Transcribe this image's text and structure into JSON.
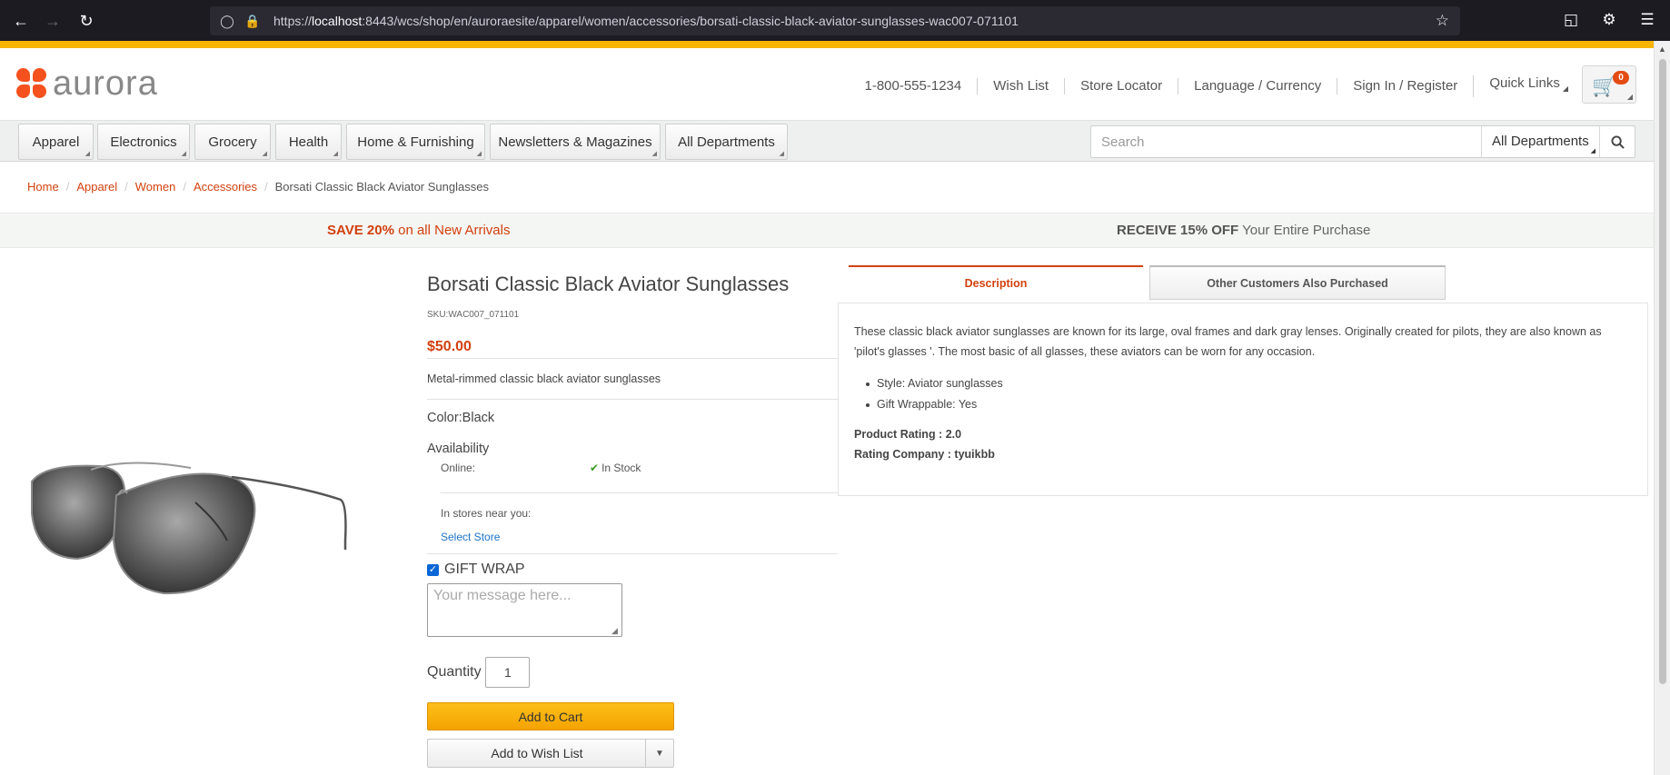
{
  "browser": {
    "url_prefix": "https://",
    "url_host": "localhost",
    "url_rest": ":8443/wcs/shop/en/auroraesite/apparel/women/accessories/borsati-classic-black-aviator-sunglasses-wac007-071101"
  },
  "header": {
    "logo_text": "aurora",
    "links": [
      "1-800-555-1234",
      "Wish List",
      "Store Locator",
      "Language / Currency",
      "Sign In / Register",
      "Quick Links"
    ],
    "cart_count": "0"
  },
  "departments": [
    "Apparel",
    "Electronics",
    "Grocery",
    "Health",
    "Home & Furnishing",
    "Newsletters & Magazines",
    "All Departments"
  ],
  "search": {
    "placeholder": "Search",
    "scope": "All Departments"
  },
  "breadcrumb": [
    "Home",
    "Apparel",
    "Women",
    "Accessories",
    "Borsati Classic Black Aviator Sunglasses"
  ],
  "promo": {
    "left_bold": "SAVE 20%",
    "left_rest": " on all New Arrivals",
    "right_bold": "RECEIVE 15% OFF",
    "right_rest": " Your Entire Purchase"
  },
  "product": {
    "title": "Borsati Classic Black Aviator Sunglasses",
    "sku": "SKU:WAC007_071101",
    "price": "$50.00",
    "short_desc": "Metal-rimmed classic black aviator sunglasses",
    "color": "Color:Black",
    "availability_label": "Availability",
    "online_label": "Online:",
    "stock_status": "In Stock",
    "stores_label": "In stores near you:",
    "select_store": "Select Store",
    "gift_wrap_label": "GIFT WRAP",
    "gift_wrap_checked": true,
    "gift_msg_placeholder": "Your message here...",
    "quantity_label": "Quantity",
    "quantity_value": "1",
    "add_to_cart": "Add to Cart",
    "add_to_wishlist": "Add to Wish List"
  },
  "tabs": {
    "description": "Description",
    "other": "Other Customers Also Purchased"
  },
  "description": {
    "text": "These classic black aviator sunglasses are known for its large, oval frames and dark gray lenses. Originally created for pilots, they are also known as 'pilot's glasses '. The most basic of all glasses, these aviators can be worn for any occasion.",
    "bullets": [
      "Style: Aviator sunglasses",
      "Gift Wrappable: Yes"
    ],
    "rating": "Product Rating : 2.0",
    "rating_company": "Rating Company : tyuikbb"
  },
  "colors": {
    "accent": "#d2410f",
    "cart_button": "#f4a300",
    "strip": "#f7b500"
  }
}
